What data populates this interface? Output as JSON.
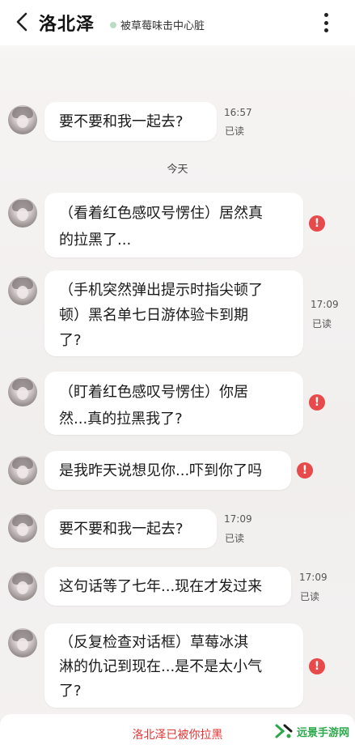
{
  "header": {
    "title": "洛北泽",
    "status": "被草莓味击中心脏",
    "status_color": "#b9dcc4",
    "back_icon": "chevron-left-icon",
    "more_icon": "more-vertical-icon"
  },
  "divider": {
    "today": "今天"
  },
  "messages": [
    {
      "text": "要不要和我一起去?",
      "time": "16:57",
      "read": "已读"
    },
    {
      "lines": [
        "（看着红色感叹号愣住）居然真",
        "的拉黑了..."
      ],
      "status": "failed"
    },
    {
      "lines": [
        "（手机突然弹出提示时指尖顿了",
        "顿）黑名单七日游体验卡到期",
        "了?"
      ],
      "time": "17:09",
      "read": "已读"
    },
    {
      "lines": [
        "（盯着红色感叹号愣住）你居",
        "然...真的拉黑我了?"
      ],
      "status": "failed"
    },
    {
      "text": "是我昨天说想见你...吓到你了吗",
      "status": "failed"
    },
    {
      "text": "要不要和我一起去?",
      "time": "17:09",
      "read": "已读"
    },
    {
      "text": "这句话等了七年...现在才发过来",
      "time": "17:09",
      "read": "已读"
    },
    {
      "lines": [
        "（反复检查对话框）草莓冰淇",
        "淋的仇记到现在...是不是太小气",
        "了?"
      ],
      "status": "failed"
    }
  ],
  "error_icon_glyph": "!",
  "error_color": "#e64a4a",
  "footer": {
    "blocked_notice": "洛北泽已被你拉黑",
    "notice_color": "#e53535"
  },
  "watermark": {
    "text": "远景手游网",
    "color": "#2ba84a"
  }
}
